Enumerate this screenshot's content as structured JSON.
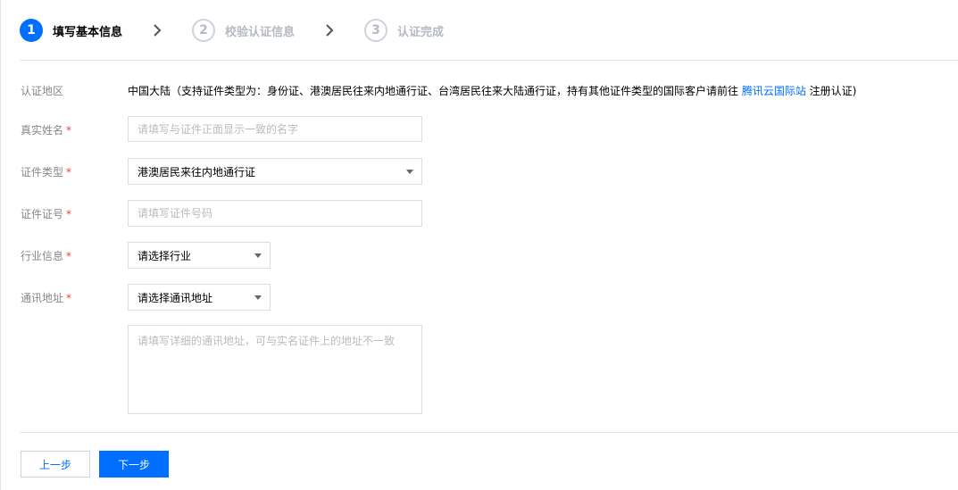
{
  "steps": [
    {
      "number": "1",
      "label": "填写基本信息"
    },
    {
      "number": "2",
      "label": "校验认证信息"
    },
    {
      "number": "3",
      "label": "认证完成"
    }
  ],
  "form": {
    "region": {
      "label": "认证地区",
      "text_before": "中国大陆（支持证件类型为：身份证、港澳居民往来内地通行证、台湾居民往来大陆通行证，持有其他证件类型的国际客户请前往 ",
      "link": "腾讯云国际站",
      "text_after": " 注册认证)"
    },
    "name": {
      "label": "真实姓名",
      "required_mark": "*",
      "value": "",
      "placeholder": "请填写与证件正面显示一致的名字"
    },
    "id_type": {
      "label": "证件类型",
      "required_mark": "*",
      "selected": "港澳居民来往内地通行证"
    },
    "id_number": {
      "label": "证件证号",
      "required_mark": "*",
      "value": "",
      "placeholder": "请填写证件号码"
    },
    "industry": {
      "label": "行业信息",
      "required_mark": "*",
      "selected": "请选择行业"
    },
    "address": {
      "label": "通讯地址",
      "required_mark": "*",
      "selected": "请选择通讯地址",
      "detail_value": "",
      "detail_placeholder": "请填写详细的通讯地址，可与实名证件上的地址不一致"
    }
  },
  "buttons": {
    "prev": "上一步",
    "next": "下一步"
  },
  "colors": {
    "accent": "#006eff",
    "required": "#e54545",
    "inactive_step": "#b5bac1",
    "label": "#888888"
  },
  "icons": {
    "step_separator": "chevron-right-icon",
    "select_caret": "caret-down-icon"
  }
}
